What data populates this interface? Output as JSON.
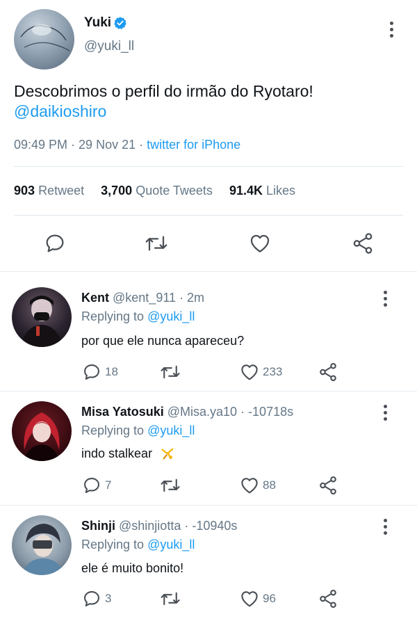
{
  "main_tweet": {
    "display_name": "Yuki",
    "handle": "@yuki_ll",
    "text": "Descobrimos o perfil do irmão do Ryotaro!",
    "mention": "@daikioshiro",
    "time": "09:49 PM",
    "separator": " · ",
    "date": "29 Nov 21",
    "source": "twitter for iPhone",
    "stats": {
      "retweets_count": "903",
      "retweets_label": "Retweet",
      "quotes_count": "3,700",
      "quotes_label": "Quote Tweets",
      "likes_count": "91.4K",
      "likes_label": "Likes"
    }
  },
  "replying_to_label": "Replying to",
  "replies": [
    {
      "name": "Kent",
      "handle_time": "@kent_911 · 2m",
      "replying_to": "@yuki_ll",
      "text": "por que ele nunca apareceu?",
      "reply_count": "18",
      "like_count": "233"
    },
    {
      "name": "Misa Yatosuki",
      "handle_time": "@Misa.ya10 · -10718s",
      "replying_to": "@yuki_ll",
      "text": "indo stalkear",
      "reply_count": "7",
      "like_count": "88"
    },
    {
      "name": "Shinji",
      "handle_time": "@shinjiotta · -10940s",
      "replying_to": "@yuki_ll",
      "text": "ele é muito bonito!",
      "reply_count": "3",
      "like_count": "96"
    }
  ],
  "colors": {
    "accent": "#1d9bf0",
    "muted": "#657786",
    "text": "#0f1419",
    "divider": "#e1e8ed"
  },
  "icons": [
    "verified-badge-icon",
    "more-icon",
    "reply-icon",
    "retweet-icon",
    "like-icon",
    "share-icon"
  ]
}
